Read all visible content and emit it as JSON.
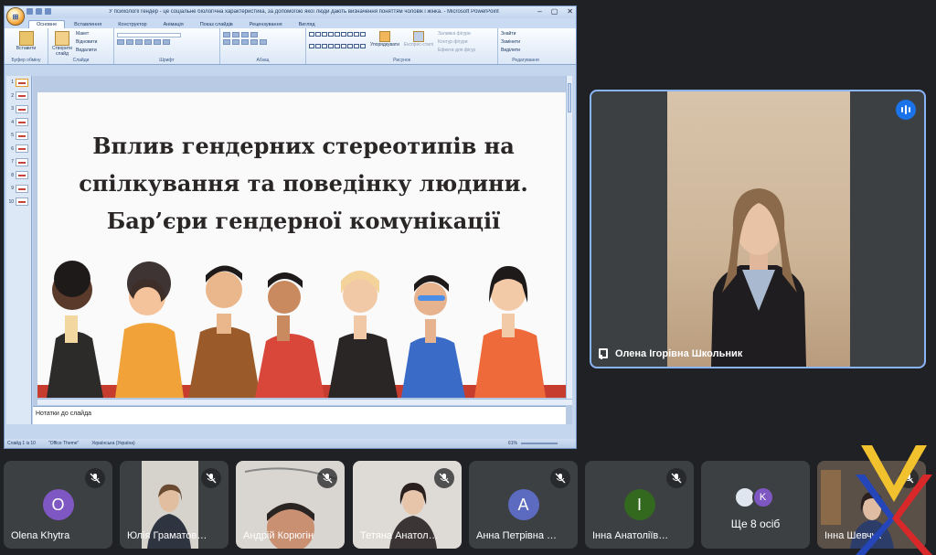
{
  "ppt": {
    "window_title": "У психології гендер - це соціальне біологічна характеристика, за допомогою якої люди дають визначення поняттям чоловік і жінка. - Microsoft PowerPoint",
    "tabs": [
      "Основне",
      "Вставлення",
      "Конструктор",
      "Анімація",
      "Показ слайдів",
      "Рецензування",
      "Вигляд"
    ],
    "groups": {
      "clipboard": "Буфер обміну",
      "slides": "Слайди",
      "font": "Шрифт",
      "paragraph": "Абзац",
      "drawing": "Рисунок",
      "editing": "Редагування"
    },
    "ribbon_labels": {
      "paste": "Вставити",
      "new_slide": "Створити слайд",
      "layout": "Макет",
      "reset": "Відновити",
      "delete": "Видалити",
      "arrange": "Упорядкувати",
      "quick_styles": "Експрес-стилі",
      "shape_fill": "Заливка фігури",
      "shape_outline": "Контур фігури",
      "shape_effects": "Ефекти для фігур",
      "find": "Знайти",
      "replace": "Замінити",
      "select": "Виділити"
    },
    "slide_numbers": [
      "1",
      "2",
      "3",
      "4",
      "5",
      "6",
      "7",
      "8",
      "9",
      "10"
    ],
    "slide_title": "Вплив гендерних стереотипів на спілкування та поведінку людини. Бар’єри гендерної комунікації",
    "notes_placeholder": "Нотатки до слайда",
    "status": {
      "slide": "Слайд 1 із 10",
      "theme": "\"Office Theme\"",
      "language": "Українська (Україна)",
      "zoom": "61%"
    }
  },
  "speaker": {
    "name": "Олена Ігорівна Школьник"
  },
  "participants": [
    {
      "name": "Olena Khytra",
      "initial": "O",
      "color": "#7e57c2",
      "type": "avatar"
    },
    {
      "name": "Юлія Граматов…",
      "type": "video"
    },
    {
      "name": "Андрій Корюгін",
      "type": "video"
    },
    {
      "name": "Тетяна Анатол…",
      "type": "video"
    },
    {
      "name": "Анна Петрівна …",
      "initial": "A",
      "color": "#5c6bc0",
      "type": "avatar"
    },
    {
      "name": "Інна Анатоліїв…",
      "initial": "I",
      "color": "#33691e",
      "type": "avatar"
    },
    {
      "name": "Ще 8 осіб",
      "initial": "K",
      "type": "more"
    },
    {
      "name": "Інна Шевчук",
      "type": "video"
    }
  ],
  "colors": {
    "meet_bg": "#202124",
    "tile_bg": "#3c4043",
    "active_speaker_border": "#8ab4f8",
    "speaking_indicator": "#1a73e8"
  }
}
